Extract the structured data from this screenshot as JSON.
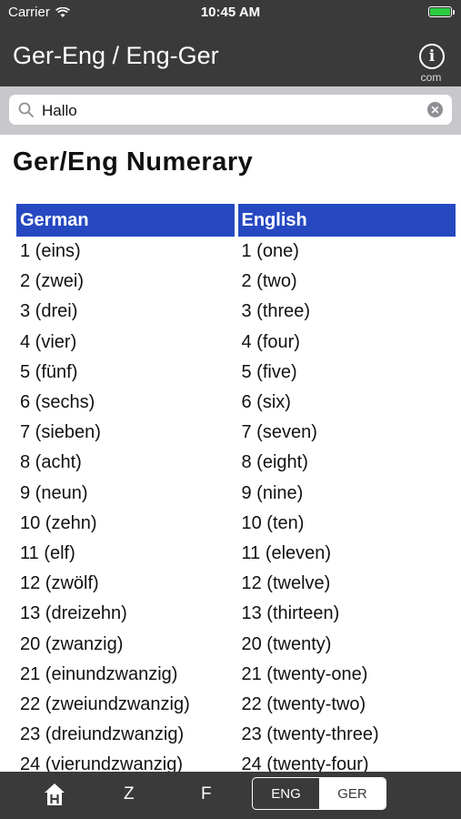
{
  "status_bar": {
    "carrier": "Carrier",
    "time": "10:45 AM"
  },
  "nav": {
    "title": "Ger-Eng / Eng-Ger",
    "info_label": "com"
  },
  "search": {
    "value": "Hallo"
  },
  "page": {
    "heading": "Ger/Eng Numerary"
  },
  "table": {
    "headers": [
      "German",
      "English"
    ],
    "rows": [
      [
        "1 (eins)",
        "1 (one)"
      ],
      [
        "2 (zwei)",
        "2 (two)"
      ],
      [
        "3 (drei)",
        "3 (three)"
      ],
      [
        "4 (vier)",
        "4 (four)"
      ],
      [
        "5 (fünf)",
        "5 (five)"
      ],
      [
        "6 (sechs)",
        "6 (six)"
      ],
      [
        "7 (sieben)",
        "7 (seven)"
      ],
      [
        "8 (acht)",
        "8 (eight)"
      ],
      [
        "9 (neun)",
        "9 (nine)"
      ],
      [
        "10 (zehn)",
        "10 (ten)"
      ],
      [
        "11 (elf)",
        "11 (eleven)"
      ],
      [
        "12 (zwölf)",
        "12 (twelve)"
      ],
      [
        "13 (dreizehn)",
        "13 (thirteen)"
      ],
      [
        "20 (zwanzig)",
        "20 (twenty)"
      ],
      [
        "21 (einundzwanzig)",
        "21 (twenty-one)"
      ],
      [
        "22 (zweiundzwanzig)",
        "22 (twenty-two)"
      ],
      [
        "23 (dreiundzwanzig)",
        "23 (twenty-three)"
      ],
      [
        "24 (vierundzwanzig)",
        "24 (twenty-four)"
      ]
    ]
  },
  "tab_bar": {
    "z_label": "Z",
    "f_label": "F",
    "eng_label": "ENG",
    "ger_label": "GER",
    "selected": "GER"
  },
  "colors": {
    "bar": "#3a3a3a",
    "header_blue": "#2649c1",
    "battery": "#2ecc40"
  }
}
